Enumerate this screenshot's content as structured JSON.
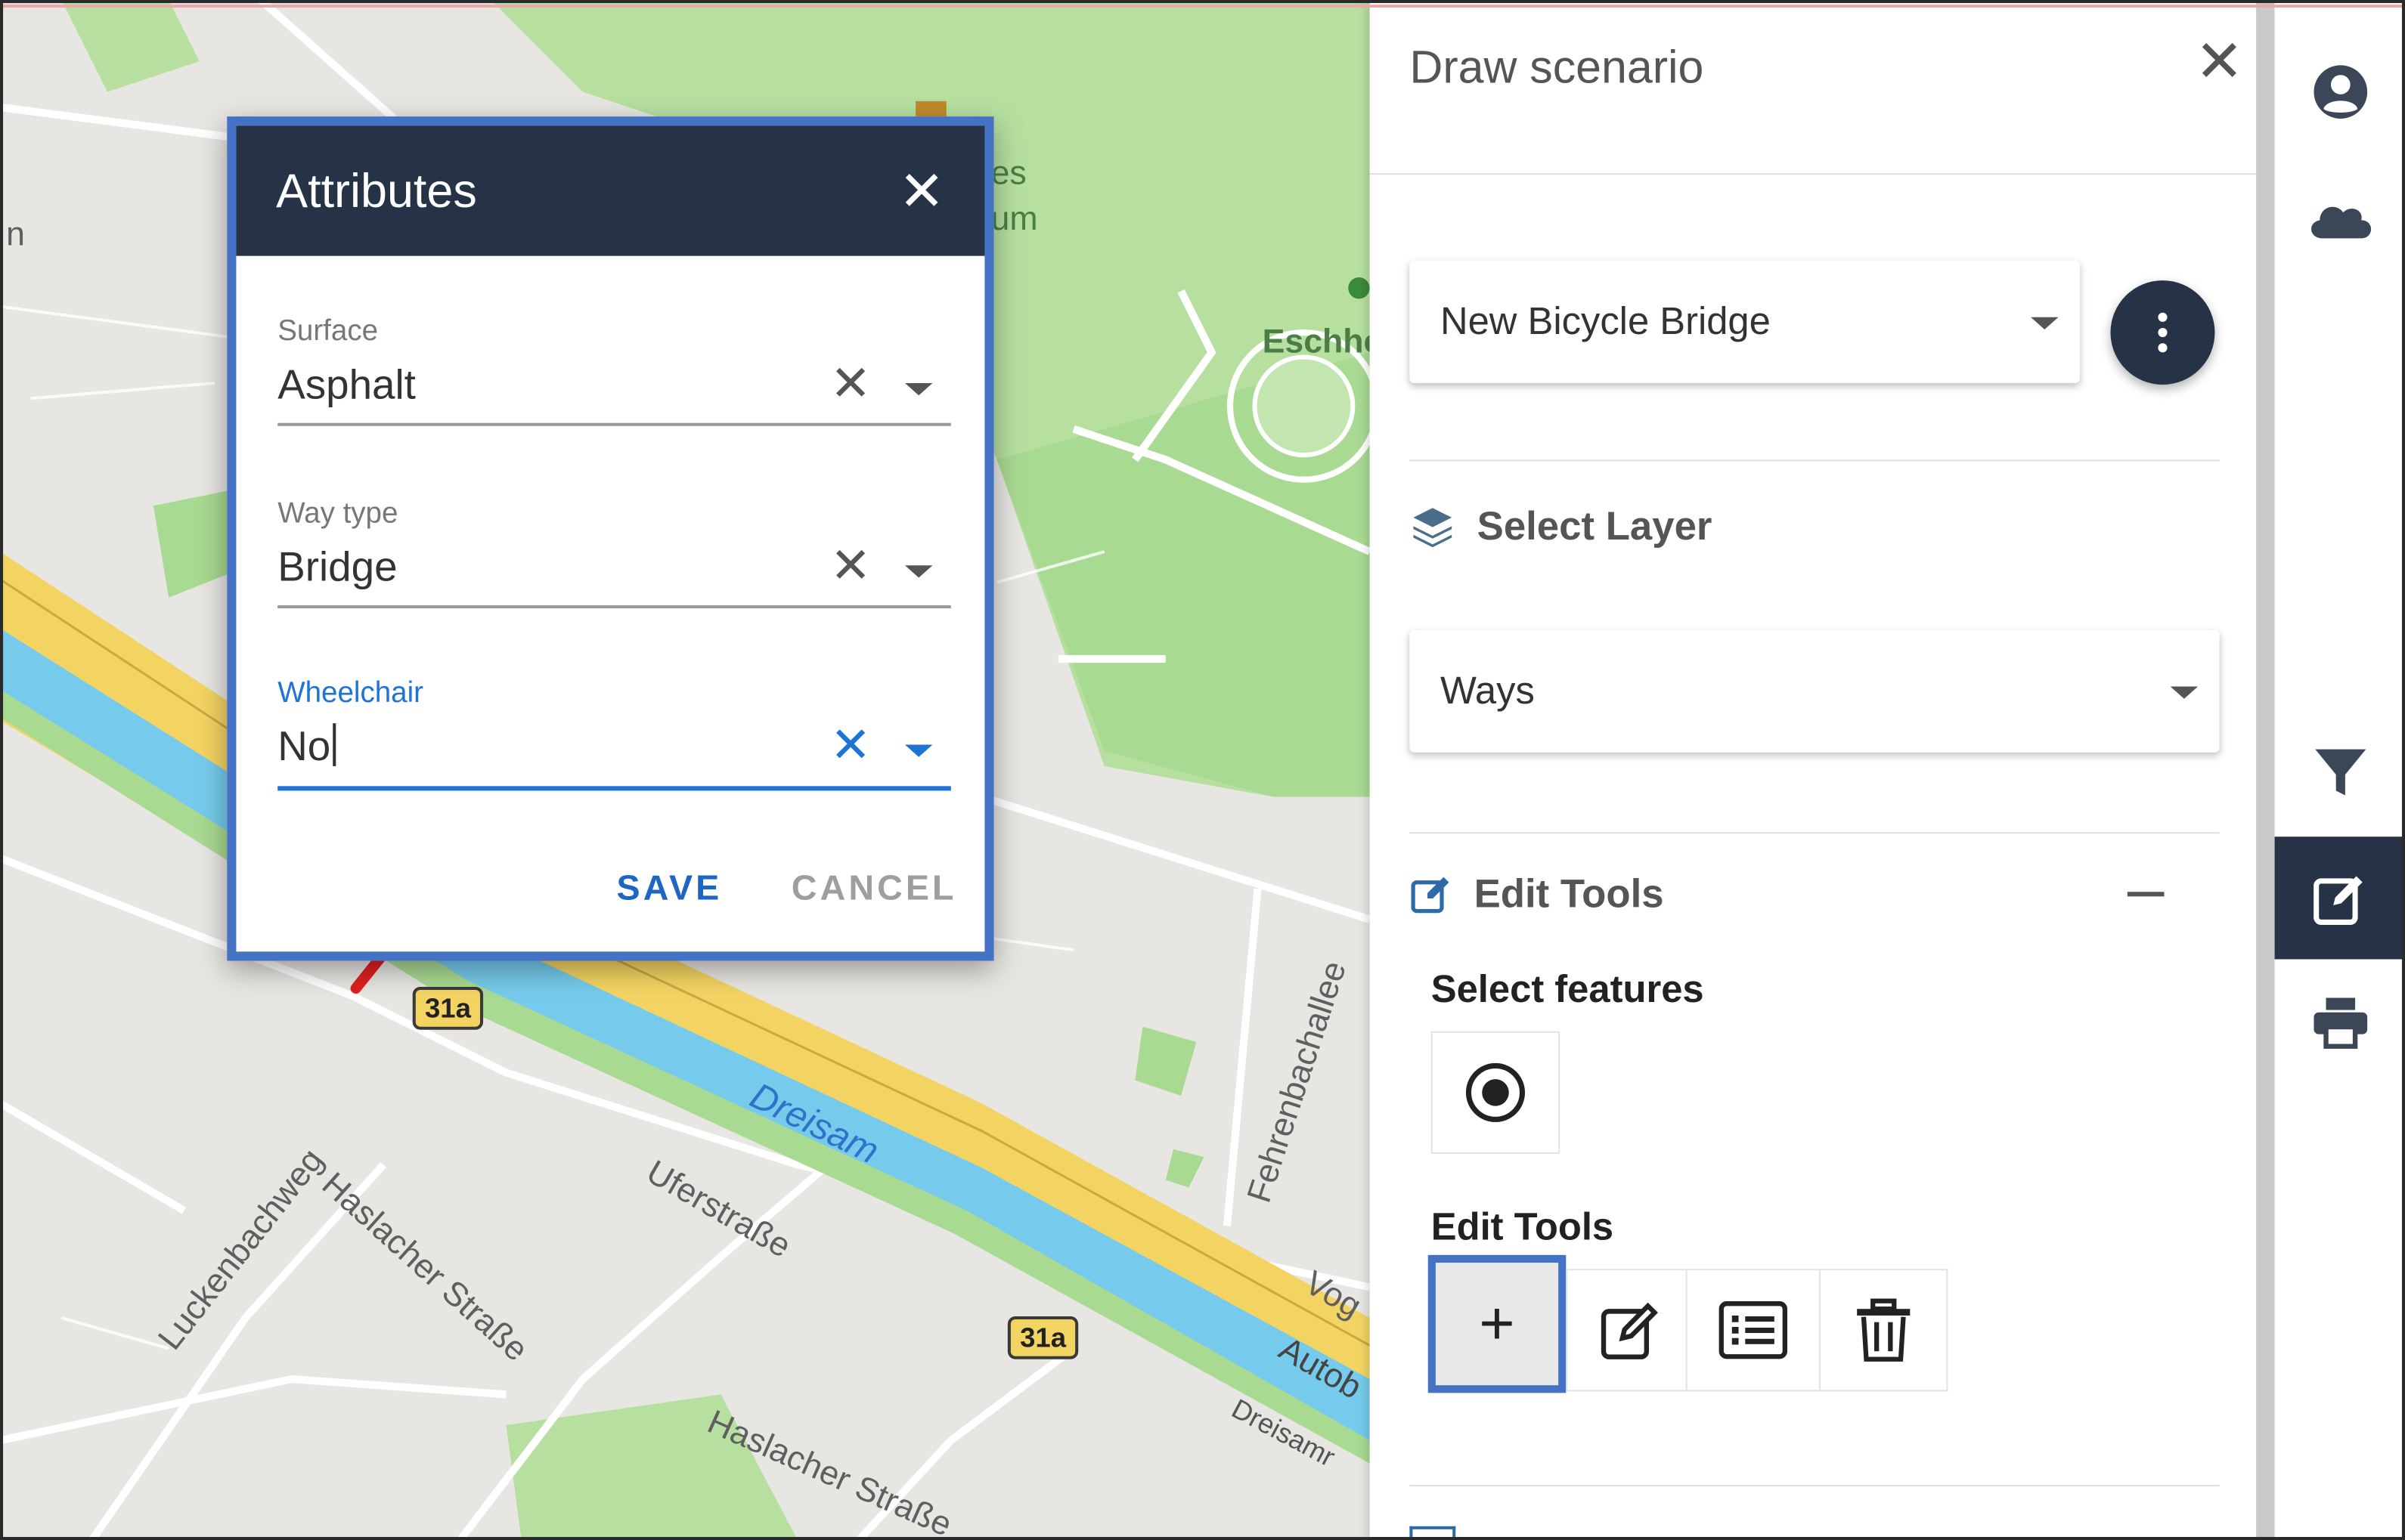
{
  "map": {
    "labels": {
      "eschholz": "Eschho",
      "museum_1": "es",
      "museum_2": "um",
      "n_left": "n",
      "dreisam": "Dreisam",
      "haslacher_1": "Haslacher Straße",
      "haslacher_2": "Haslacher Straße",
      "uferstrasse": "Uferstraße",
      "luckenbachweg": "Luckenbachweg",
      "fehrenbachallee": "Fehrenbachallee",
      "vog": "Vog",
      "auto": "Autob",
      "dreisamr": "Dreisamr"
    },
    "shields": [
      "31a",
      "31a"
    ]
  },
  "attributes_dialog": {
    "title": "Attributes",
    "fields": [
      {
        "label": "Surface",
        "value": "Asphalt"
      },
      {
        "label": "Way type",
        "value": "Bridge"
      },
      {
        "label": "Wheelchair",
        "value": "No"
      }
    ],
    "save_label": "SAVE",
    "cancel_label": "CANCEL"
  },
  "panel": {
    "title": "Draw scenario",
    "scenario_select": "New Bicycle Bridge",
    "select_layer_heading": "Select Layer",
    "layer_select": "Ways",
    "edit_tools_heading": "Edit Tools",
    "select_features_label": "Select features",
    "edit_tools_label": "Edit Tools"
  },
  "colors": {
    "header_navy": "#263346",
    "highlight_blue": "#4472c4",
    "active_field_blue": "#1e73d6",
    "river": "#76cbec",
    "motorway": "#f3d463",
    "park": "#b5df9c"
  },
  "icons": {
    "rail": [
      "account-icon",
      "cloud-icon",
      "filter-icon",
      "edit-icon",
      "print-icon"
    ],
    "panel": [
      "layers-icon",
      "edit-square-icon",
      "radio-select-icon",
      "pencil-icon",
      "list-icon",
      "trash-icon"
    ]
  }
}
